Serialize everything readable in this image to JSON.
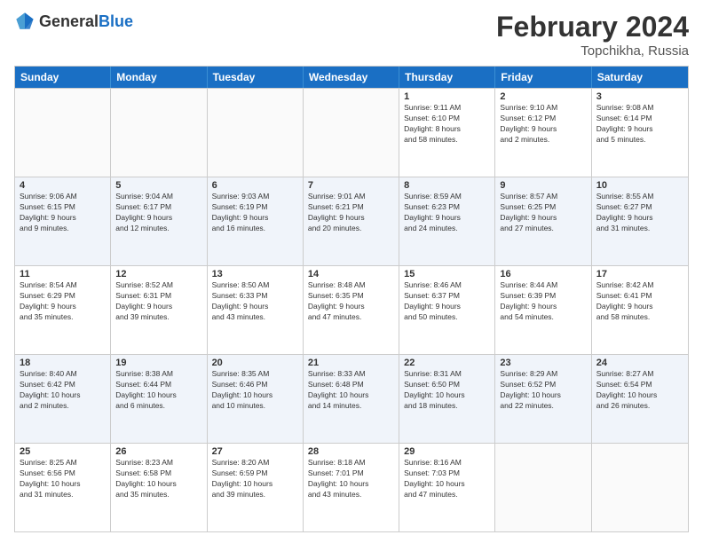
{
  "header": {
    "logo_general": "General",
    "logo_blue": "Blue",
    "title": "February 2024",
    "subtitle": "Topchikha, Russia"
  },
  "days_of_week": [
    "Sunday",
    "Monday",
    "Tuesday",
    "Wednesday",
    "Thursday",
    "Friday",
    "Saturday"
  ],
  "weeks": [
    [
      {
        "day": "",
        "info": ""
      },
      {
        "day": "",
        "info": ""
      },
      {
        "day": "",
        "info": ""
      },
      {
        "day": "",
        "info": ""
      },
      {
        "day": "1",
        "info": "Sunrise: 9:11 AM\nSunset: 6:10 PM\nDaylight: 8 hours\nand 58 minutes."
      },
      {
        "day": "2",
        "info": "Sunrise: 9:10 AM\nSunset: 6:12 PM\nDaylight: 9 hours\nand 2 minutes."
      },
      {
        "day": "3",
        "info": "Sunrise: 9:08 AM\nSunset: 6:14 PM\nDaylight: 9 hours\nand 5 minutes."
      }
    ],
    [
      {
        "day": "4",
        "info": "Sunrise: 9:06 AM\nSunset: 6:15 PM\nDaylight: 9 hours\nand 9 minutes."
      },
      {
        "day": "5",
        "info": "Sunrise: 9:04 AM\nSunset: 6:17 PM\nDaylight: 9 hours\nand 12 minutes."
      },
      {
        "day": "6",
        "info": "Sunrise: 9:03 AM\nSunset: 6:19 PM\nDaylight: 9 hours\nand 16 minutes."
      },
      {
        "day": "7",
        "info": "Sunrise: 9:01 AM\nSunset: 6:21 PM\nDaylight: 9 hours\nand 20 minutes."
      },
      {
        "day": "8",
        "info": "Sunrise: 8:59 AM\nSunset: 6:23 PM\nDaylight: 9 hours\nand 24 minutes."
      },
      {
        "day": "9",
        "info": "Sunrise: 8:57 AM\nSunset: 6:25 PM\nDaylight: 9 hours\nand 27 minutes."
      },
      {
        "day": "10",
        "info": "Sunrise: 8:55 AM\nSunset: 6:27 PM\nDaylight: 9 hours\nand 31 minutes."
      }
    ],
    [
      {
        "day": "11",
        "info": "Sunrise: 8:54 AM\nSunset: 6:29 PM\nDaylight: 9 hours\nand 35 minutes."
      },
      {
        "day": "12",
        "info": "Sunrise: 8:52 AM\nSunset: 6:31 PM\nDaylight: 9 hours\nand 39 minutes."
      },
      {
        "day": "13",
        "info": "Sunrise: 8:50 AM\nSunset: 6:33 PM\nDaylight: 9 hours\nand 43 minutes."
      },
      {
        "day": "14",
        "info": "Sunrise: 8:48 AM\nSunset: 6:35 PM\nDaylight: 9 hours\nand 47 minutes."
      },
      {
        "day": "15",
        "info": "Sunrise: 8:46 AM\nSunset: 6:37 PM\nDaylight: 9 hours\nand 50 minutes."
      },
      {
        "day": "16",
        "info": "Sunrise: 8:44 AM\nSunset: 6:39 PM\nDaylight: 9 hours\nand 54 minutes."
      },
      {
        "day": "17",
        "info": "Sunrise: 8:42 AM\nSunset: 6:41 PM\nDaylight: 9 hours\nand 58 minutes."
      }
    ],
    [
      {
        "day": "18",
        "info": "Sunrise: 8:40 AM\nSunset: 6:42 PM\nDaylight: 10 hours\nand 2 minutes."
      },
      {
        "day": "19",
        "info": "Sunrise: 8:38 AM\nSunset: 6:44 PM\nDaylight: 10 hours\nand 6 minutes."
      },
      {
        "day": "20",
        "info": "Sunrise: 8:35 AM\nSunset: 6:46 PM\nDaylight: 10 hours\nand 10 minutes."
      },
      {
        "day": "21",
        "info": "Sunrise: 8:33 AM\nSunset: 6:48 PM\nDaylight: 10 hours\nand 14 minutes."
      },
      {
        "day": "22",
        "info": "Sunrise: 8:31 AM\nSunset: 6:50 PM\nDaylight: 10 hours\nand 18 minutes."
      },
      {
        "day": "23",
        "info": "Sunrise: 8:29 AM\nSunset: 6:52 PM\nDaylight: 10 hours\nand 22 minutes."
      },
      {
        "day": "24",
        "info": "Sunrise: 8:27 AM\nSunset: 6:54 PM\nDaylight: 10 hours\nand 26 minutes."
      }
    ],
    [
      {
        "day": "25",
        "info": "Sunrise: 8:25 AM\nSunset: 6:56 PM\nDaylight: 10 hours\nand 31 minutes."
      },
      {
        "day": "26",
        "info": "Sunrise: 8:23 AM\nSunset: 6:58 PM\nDaylight: 10 hours\nand 35 minutes."
      },
      {
        "day": "27",
        "info": "Sunrise: 8:20 AM\nSunset: 6:59 PM\nDaylight: 10 hours\nand 39 minutes."
      },
      {
        "day": "28",
        "info": "Sunrise: 8:18 AM\nSunset: 7:01 PM\nDaylight: 10 hours\nand 43 minutes."
      },
      {
        "day": "29",
        "info": "Sunrise: 8:16 AM\nSunset: 7:03 PM\nDaylight: 10 hours\nand 47 minutes."
      },
      {
        "day": "",
        "info": ""
      },
      {
        "day": "",
        "info": ""
      }
    ]
  ]
}
